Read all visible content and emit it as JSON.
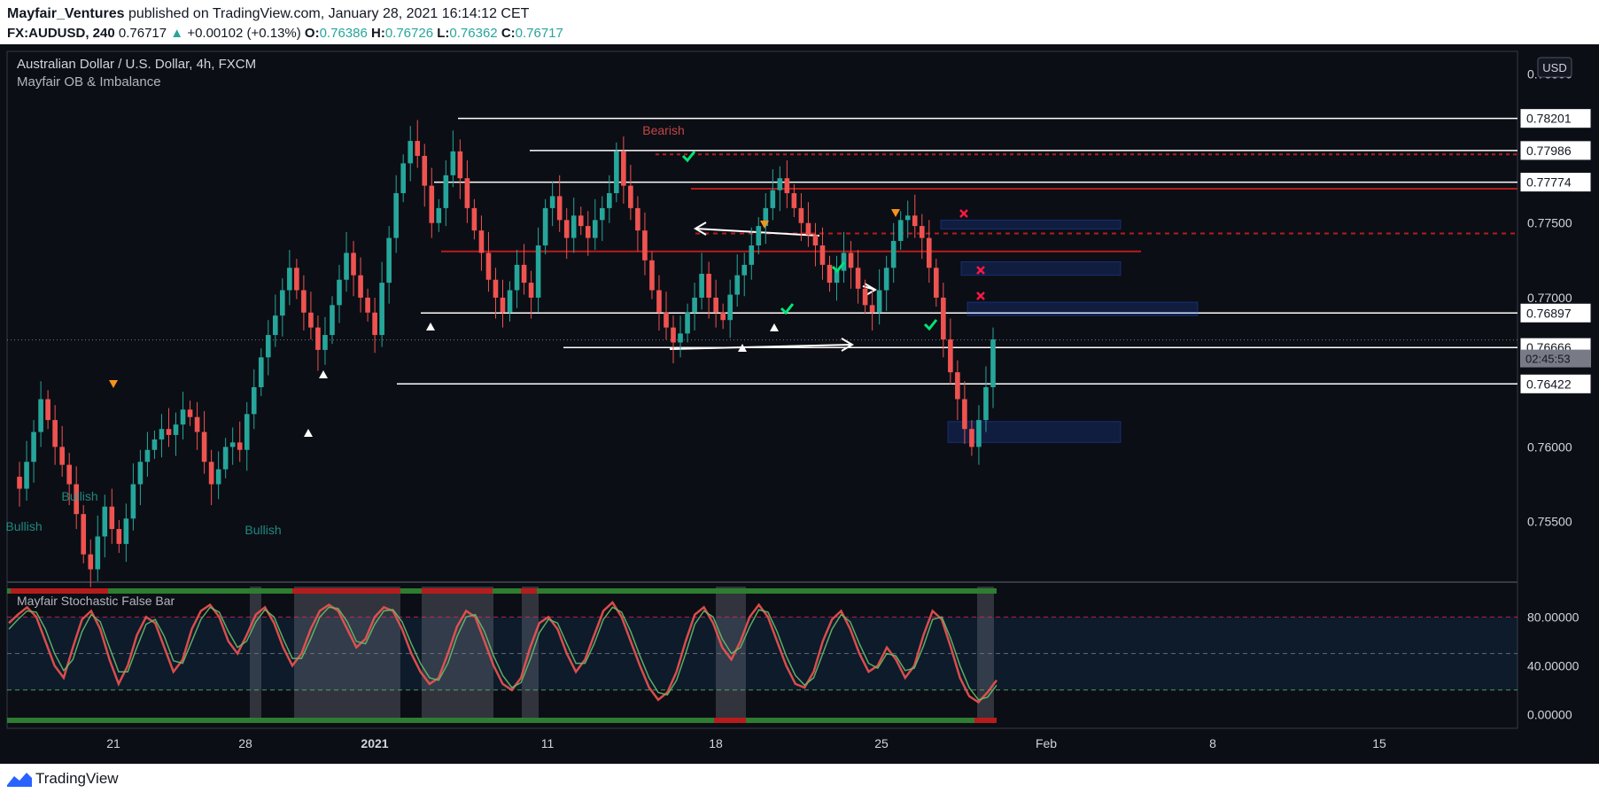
{
  "header": {
    "author": "Mayfair_Ventures",
    "published": "published on TradingView.com, January 28, 2021 16:14:12 CET",
    "symbol": "FX:AUDUSD, 240",
    "last": "0.76717",
    "change": "+0.00102 (+0.13%)",
    "o_label": "O:",
    "o_value": "0.76386",
    "h_label": "H:",
    "h_value": "0.76726",
    "l_label": "L:",
    "l_value": "0.76362",
    "c_label": "C:",
    "c_value": "0.76717"
  },
  "pane": {
    "title": "Australian Dollar / U.S. Dollar, 4h, FXCM",
    "indicator": "Mayfair OB & Imbalance",
    "currency": "USD",
    "countdown": "02:45:53",
    "osc_title": "Mayfair Stochastic False Bar"
  },
  "footer": {
    "brand": "TradingView"
  },
  "colors": {
    "up": "#26a69a",
    "down": "#ef5350",
    "bg": "#0c0e15",
    "orange": "#f7931a",
    "darkred": "#b71c1c"
  },
  "chart_data": [
    {
      "type": "candlestick",
      "title": "Australian Dollar / U.S. Dollar, 4h, FXCM",
      "ylim": [
        0.751,
        0.7865
      ],
      "y_ticks": [
        "0.78500",
        "0.77500",
        "0.77000",
        "0.76000",
        "0.75500"
      ],
      "x_ticks": [
        "21",
        "28",
        "2021",
        "11",
        "18",
        "25",
        "Feb",
        "8",
        "15"
      ],
      "price_levels": [
        "0.78201",
        "0.77986",
        "0.77774",
        "0.76897",
        "0.76666",
        "0.76422"
      ],
      "current_price": "0.76717",
      "labels": [
        "Bearish",
        "Bullish",
        "Bullish",
        "Bullish"
      ],
      "path": [
        0.758,
        0.7572,
        0.759,
        0.761,
        0.7632,
        0.7618,
        0.76,
        0.7588,
        0.7575,
        0.7555,
        0.7528,
        0.7518,
        0.754,
        0.756,
        0.7545,
        0.7535,
        0.7552,
        0.7575,
        0.759,
        0.7598,
        0.7605,
        0.7612,
        0.7608,
        0.7615,
        0.7625,
        0.762,
        0.761,
        0.759,
        0.7575,
        0.7585,
        0.76,
        0.7603,
        0.7598,
        0.7622,
        0.764,
        0.766,
        0.7675,
        0.7688,
        0.7705,
        0.772,
        0.7705,
        0.769,
        0.768,
        0.7665,
        0.7675,
        0.7695,
        0.7712,
        0.773,
        0.7715,
        0.77,
        0.769,
        0.7675,
        0.771,
        0.774,
        0.777,
        0.779,
        0.7805,
        0.7795,
        0.7775,
        0.775,
        0.776,
        0.7782,
        0.7798,
        0.778,
        0.776,
        0.7745,
        0.773,
        0.7712,
        0.77,
        0.769,
        0.7705,
        0.7722,
        0.771,
        0.77,
        0.7735,
        0.776,
        0.7768,
        0.7752,
        0.774,
        0.7755,
        0.7748,
        0.774,
        0.7752,
        0.776,
        0.777,
        0.7798,
        0.7775,
        0.776,
        0.7745,
        0.7725,
        0.7705,
        0.769,
        0.768,
        0.767,
        0.7676,
        0.769,
        0.77,
        0.7716,
        0.77,
        0.769,
        0.7685,
        0.7702,
        0.7715,
        0.7722,
        0.7735,
        0.7748,
        0.776,
        0.7772,
        0.778,
        0.777,
        0.776,
        0.775,
        0.7742,
        0.7735,
        0.7722,
        0.771,
        0.7718,
        0.773,
        0.772,
        0.7706,
        0.7695,
        0.769,
        0.7705,
        0.772,
        0.7738,
        0.7752,
        0.7755,
        0.7748,
        0.774,
        0.772,
        0.77,
        0.7672,
        0.765,
        0.7632,
        0.7612,
        0.76,
        0.7618,
        0.764,
        0.7672
      ]
    },
    {
      "type": "line",
      "title": "Mayfair Stochastic False Bar",
      "ylim": [
        -10,
        105
      ],
      "y_ticks": [
        "80.00000",
        "40.00000",
        "0.00000"
      ],
      "levels": [
        80,
        20,
        50
      ],
      "series": [
        {
          "values": [
            75,
            82,
            88,
            80,
            60,
            40,
            30,
            55,
            78,
            85,
            70,
            45,
            25,
            40,
            65,
            80,
            75,
            55,
            35,
            45,
            70,
            85,
            90,
            80,
            60,
            50,
            65,
            82,
            88,
            75,
            55,
            40,
            50,
            70,
            85,
            90,
            85,
            70,
            55,
            62,
            80,
            88,
            85,
            70,
            50,
            35,
            25,
            30,
            50,
            72,
            85,
            80,
            60,
            40,
            25,
            20,
            30,
            55,
            75,
            80,
            70,
            50,
            35,
            45,
            65,
            85,
            92,
            80,
            60,
            40,
            22,
            12,
            18,
            35,
            60,
            82,
            88,
            75,
            55,
            45,
            60,
            80,
            90,
            80,
            60,
            40,
            25,
            22,
            35,
            60,
            78,
            85,
            70,
            50,
            35,
            40,
            55,
            45,
            30,
            40,
            65,
            85,
            78,
            55,
            30,
            15,
            10,
            18,
            28
          ]
        },
        {
          "values": [
            70,
            78,
            85,
            84,
            70,
            50,
            36,
            45,
            68,
            82,
            76,
            55,
            35,
            35,
            55,
            74,
            78,
            64,
            44,
            42,
            60,
            78,
            88,
            84,
            68,
            55,
            60,
            76,
            86,
            80,
            62,
            46,
            46,
            62,
            80,
            88,
            87,
            76,
            60,
            58,
            74,
            85,
            86,
            76,
            58,
            42,
            30,
            28,
            42,
            64,
            80,
            82,
            68,
            48,
            32,
            22,
            26,
            45,
            67,
            78,
            75,
            58,
            42,
            42,
            58,
            78,
            88,
            84,
            68,
            48,
            30,
            18,
            16,
            28,
            50,
            74,
            85,
            80,
            62,
            50,
            55,
            72,
            86,
            84,
            68,
            48,
            32,
            24,
            30,
            50,
            70,
            82,
            76,
            58,
            42,
            38,
            50,
            48,
            36,
            38,
            56,
            78,
            80,
            62,
            40,
            22,
            12,
            14,
            24
          ]
        }
      ]
    }
  ]
}
